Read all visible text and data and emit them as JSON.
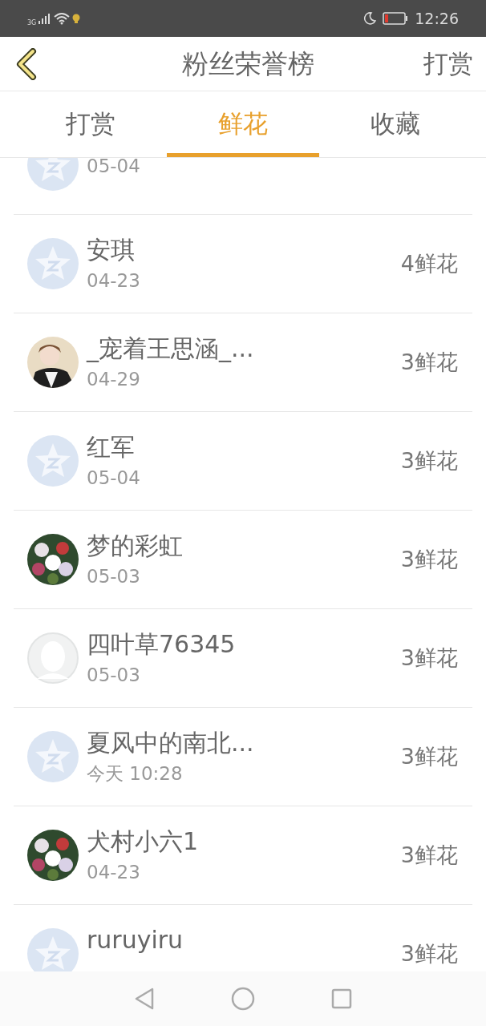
{
  "status_bar": {
    "network": "3G",
    "time": "12:26"
  },
  "header": {
    "title": "粉丝荣誉榜",
    "action": "打赏"
  },
  "tabs": [
    {
      "label": "打赏",
      "selected": false
    },
    {
      "label": "鲜花",
      "selected": true
    },
    {
      "label": "收藏",
      "selected": false
    }
  ],
  "fans": [
    {
      "kind": "default",
      "date": "05-04"
    },
    {
      "kind": "default",
      "name": "安琪",
      "date": "04-23",
      "count": "4鲜花"
    },
    {
      "kind": "picture",
      "name": "_宠着王思涵_...",
      "date": "04-29",
      "count": "3鲜花"
    },
    {
      "kind": "default",
      "name": "红军",
      "date": "05-04",
      "count": "3鲜花"
    },
    {
      "kind": "picture",
      "name": "梦的彩虹",
      "date": "05-03",
      "count": "3鲜花"
    },
    {
      "kind": "blank",
      "name": "四叶草76345",
      "date": "05-03",
      "count": "3鲜花"
    },
    {
      "kind": "default",
      "name": "夏风中的南北...",
      "date": "今天 10:28",
      "count": "3鲜花"
    },
    {
      "kind": "picture",
      "name": "犬村小六1",
      "date": "04-23",
      "count": "3鲜花"
    },
    {
      "kind": "default",
      "name": "ruruyiru",
      "count": "3鲜花"
    }
  ]
}
